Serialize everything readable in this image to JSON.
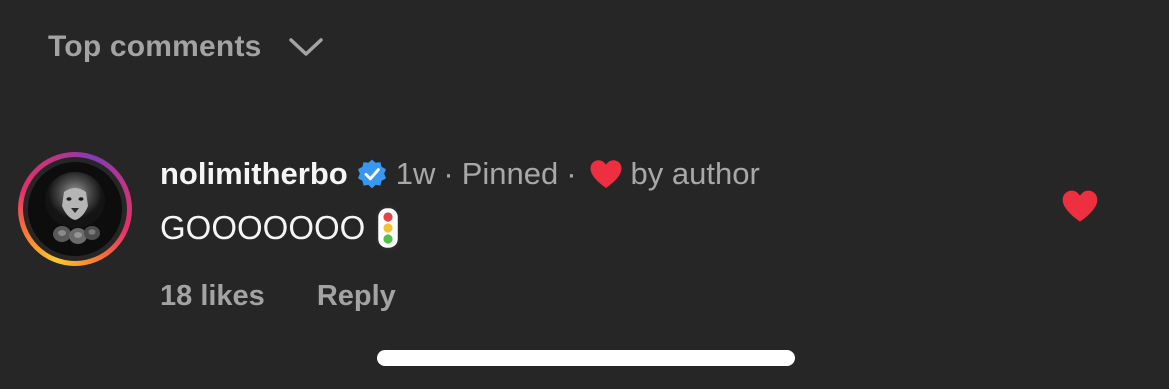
{
  "header": {
    "sort_label": "Top comments",
    "chevron_icon": "chevron-down-icon"
  },
  "comment": {
    "username": "nolimitherbo",
    "verified": true,
    "time": "1w",
    "separator": "·",
    "pinned": "Pinned",
    "author_like_text": "by author",
    "text": "GOOOOOOO",
    "emoji": "traffic-light-icon",
    "likes": "18 likes",
    "reply_label": "Reply",
    "liked": true
  },
  "colors": {
    "background": "#262626",
    "primary_text": "#f5f5f5",
    "secondary_text": "#a8a8a8",
    "heart_red": "#ed2f3f",
    "verified_blue": "#3897f0"
  }
}
